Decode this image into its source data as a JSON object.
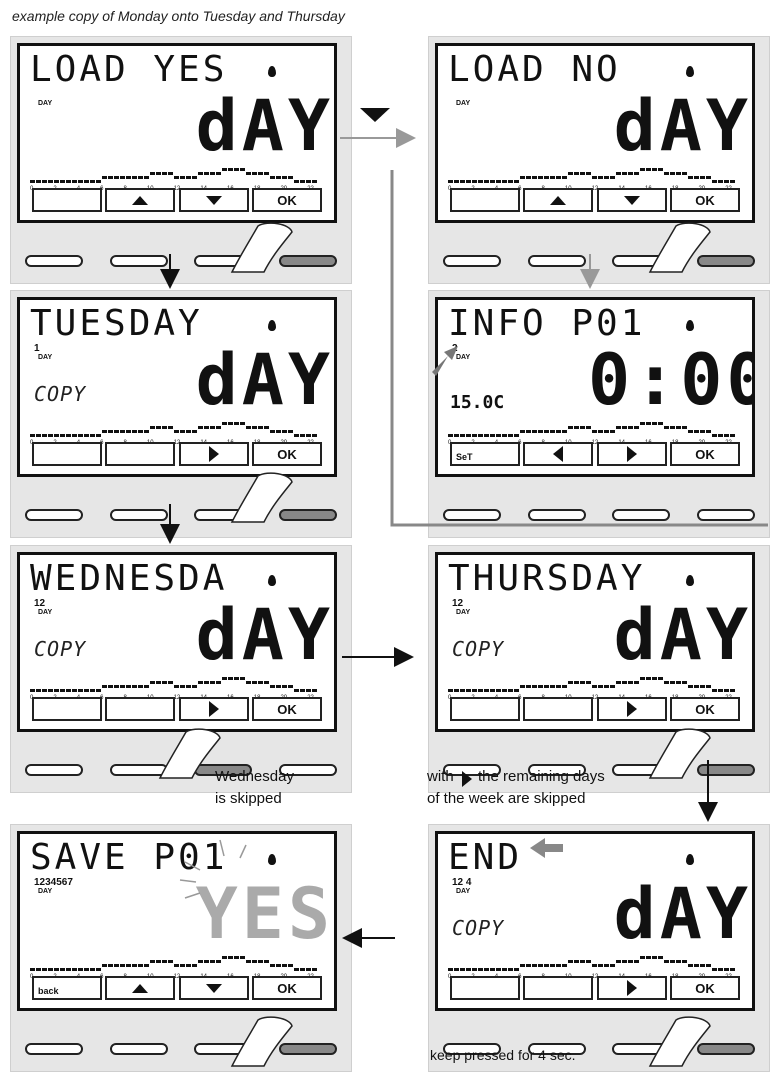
{
  "caption": "example copy of Monday onto Tuesday and Thursday",
  "panels": [
    {
      "line1": "LOAD YES",
      "nums": "",
      "copy": "",
      "big": "dAY",
      "keys": [
        "",
        "up",
        "down",
        "OK"
      ]
    },
    {
      "line1": "LOAD NO",
      "nums": "",
      "copy": "",
      "big": "dAY",
      "keys": [
        "",
        "up",
        "down",
        "OK"
      ]
    },
    {
      "line1": "TUESDAY",
      "nums": "1",
      "copy": "COPY",
      "big": "dAY",
      "keys": [
        "",
        "",
        "right",
        "OK"
      ]
    },
    {
      "line1": "INFO P01",
      "nums": "2",
      "copy": "",
      "big": "0:00",
      "temp": "15.0C",
      "keys": [
        "SeT",
        "left",
        "right",
        "OK"
      ]
    },
    {
      "line1": "WEDNESDA",
      "nums": "12",
      "copy": "COPY",
      "big": "dAY",
      "keys": [
        "",
        "",
        "right",
        "OK"
      ]
    },
    {
      "line1": "THURSDAY",
      "nums": "12",
      "copy": "COPY",
      "big": "dAY",
      "keys": [
        "",
        "",
        "right",
        "OK"
      ]
    },
    {
      "line1": "SAVE P01",
      "nums": "1234567",
      "copy": "",
      "big": "YES",
      "keys": [
        "back",
        "up",
        "down",
        "OK"
      ]
    },
    {
      "line1": "END",
      "nums": "12 4",
      "copy": "COPY",
      "big": "dAY",
      "keys": [
        "",
        "",
        "right",
        "OK"
      ]
    }
  ],
  "day_label": "DAY",
  "scale": [
    "0",
    "2",
    "4",
    "6",
    "8",
    "10",
    "12",
    "14",
    "16",
    "18",
    "20",
    "22"
  ],
  "labels": {
    "wednesday_skipped_line1": "Wednesday",
    "wednesday_skipped_line2": "is skipped",
    "remaining_line1": "with",
    "remaining_line1b": "the remaining days",
    "remaining_line2": "of the week are skipped",
    "keep_pressed": "keep pressed for 4 sec."
  }
}
